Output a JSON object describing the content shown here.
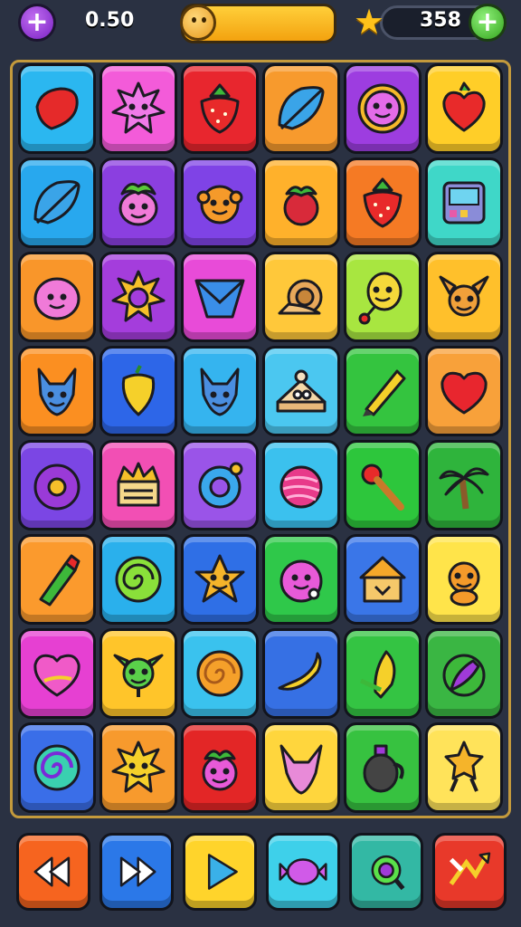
{
  "header": {
    "score": "0.50",
    "coins": "358",
    "add_symbol": "+"
  },
  "board": {
    "rows": [
      [
        {
          "icon": "leaf-heart-icon",
          "color": "#2bb7f0"
        },
        {
          "icon": "sun-creature-icon",
          "color": "#f35bd9"
        },
        {
          "icon": "strawberry-icon",
          "color": "#e8262e"
        },
        {
          "icon": "blue-leaf-icon",
          "color": "#f79a2d"
        },
        {
          "icon": "smiley-ring-icon",
          "color": "#9d3de0"
        },
        {
          "icon": "heart-fruit-icon",
          "color": "#ffce28"
        }
      ],
      [
        {
          "icon": "blue-leaf-icon",
          "color": "#28a8ee"
        },
        {
          "icon": "turnip-face-icon",
          "color": "#8b3fe0"
        },
        {
          "icon": "orange-creature-icon",
          "color": "#7f43e6"
        },
        {
          "icon": "raspberry-icon",
          "color": "#ffb12b"
        },
        {
          "icon": "strawberry-icon",
          "color": "#f57a24"
        },
        {
          "icon": "tablet-icon",
          "color": "#3fd7c8"
        }
      ],
      [
        {
          "icon": "pink-blob-icon",
          "color": "#f9962a"
        },
        {
          "icon": "sun-flower-icon",
          "color": "#a43ddc"
        },
        {
          "icon": "blue-envelope-icon",
          "color": "#e84bd8"
        },
        {
          "icon": "snail-icon",
          "color": "#ffc83a"
        },
        {
          "icon": "balloon-face-icon",
          "color": "#a8e640"
        },
        {
          "icon": "deer-face-icon",
          "color": "#ffc02b"
        }
      ],
      [
        {
          "icon": "blue-fox-icon",
          "color": "#fb8f21"
        },
        {
          "icon": "yellow-pepper-icon",
          "color": "#2d66e8"
        },
        {
          "icon": "blue-fox-icon",
          "color": "#35b4ef"
        },
        {
          "icon": "cake-slice-icon",
          "color": "#4bc7f0"
        },
        {
          "icon": "pencil-icon",
          "color": "#34c43f"
        },
        {
          "icon": "red-heart-icon",
          "color": "#f8a13a"
        }
      ],
      [
        {
          "icon": "purple-donut-icon",
          "color": "#7b46e4"
        },
        {
          "icon": "crown-box-icon",
          "color": "#f24fb4"
        },
        {
          "icon": "blue-ring-icon",
          "color": "#9a54e8"
        },
        {
          "icon": "candy-ball-icon",
          "color": "#3bc1ee"
        },
        {
          "icon": "mace-icon",
          "color": "#2dc63c"
        },
        {
          "icon": "palm-tree-icon",
          "color": "#2fb43c"
        }
      ],
      [
        {
          "icon": "green-crayon-icon",
          "color": "#fb9a2d"
        },
        {
          "icon": "green-spiral-icon",
          "color": "#2ab0ec"
        },
        {
          "icon": "star-face-icon",
          "color": "#2f6fe6"
        },
        {
          "icon": "pink-creature-icon",
          "color": "#2fc84a"
        },
        {
          "icon": "house-box-icon",
          "color": "#3a76e8"
        },
        {
          "icon": "orange-bear-icon",
          "color": "#ffe44a"
        }
      ],
      [
        {
          "icon": "pink-heart-icon",
          "color": "#e640d2"
        },
        {
          "icon": "green-alien-icon",
          "color": "#ffc52a"
        },
        {
          "icon": "spiral-orange-icon",
          "color": "#3ac2ee"
        },
        {
          "icon": "banana-icon",
          "color": "#3670e4"
        },
        {
          "icon": "corn-icon",
          "color": "#34c443"
        },
        {
          "icon": "eggplant-icon",
          "color": "#3ab643"
        }
      ],
      [
        {
          "icon": "swirl-icon",
          "color": "#3a6ee8"
        },
        {
          "icon": "sun-face-icon",
          "color": "#f79a2d"
        },
        {
          "icon": "radish-icon",
          "color": "#e32626"
        },
        {
          "icon": "pink-fox-icon",
          "color": "#ffd63d"
        },
        {
          "icon": "pot-icon",
          "color": "#37c240"
        },
        {
          "icon": "star-man-icon",
          "color": "#ffe35a"
        }
      ]
    ]
  },
  "controls": [
    {
      "icon": "rewind-icon",
      "color": "#f6641f"
    },
    {
      "icon": "fast-forward-icon",
      "color": "#2b78e8"
    },
    {
      "icon": "play-icon",
      "color": "#ffd42b"
    },
    {
      "icon": "candy-icon",
      "color": "#3ed0ea"
    },
    {
      "icon": "search-icon",
      "color": "#33b8a4"
    },
    {
      "icon": "shuffle-icon",
      "color": "#e8392a"
    }
  ]
}
